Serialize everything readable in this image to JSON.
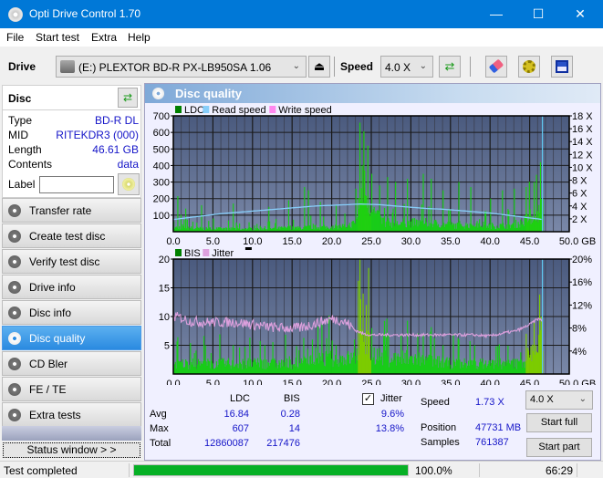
{
  "window": {
    "title": "Opti Drive Control 1.70",
    "minimize": "—",
    "maximize": "☐",
    "close": "✕"
  },
  "menu": [
    "File",
    "Start test",
    "Extra",
    "Help"
  ],
  "toolbar": {
    "drive_label": "Drive",
    "drive_value": "(E:)  PLEXTOR BD-R  PX-LB950SA 1.06",
    "speed_label": "Speed",
    "speed_value": "4.0 X",
    "eject_icon": "⏏",
    "refresh_icon": "⇄",
    "erase_icon": "eraser",
    "settings_icon": "gears",
    "save_icon": "floppy"
  },
  "disc": {
    "header": "Disc",
    "fields": [
      {
        "key": "Type",
        "value": "BD-R DL"
      },
      {
        "key": "MID",
        "value": "RITEKDR3 (000)"
      },
      {
        "key": "Length",
        "value": "46.61 GB"
      },
      {
        "key": "Contents",
        "value": "data"
      }
    ],
    "label_key": "Label",
    "label_value": ""
  },
  "nav": [
    {
      "label": "Transfer rate",
      "active": false
    },
    {
      "label": "Create test disc",
      "active": false
    },
    {
      "label": "Verify test disc",
      "active": false
    },
    {
      "label": "Drive info",
      "active": false
    },
    {
      "label": "Disc info",
      "active": false
    },
    {
      "label": "Disc quality",
      "active": true
    },
    {
      "label": "CD Bler",
      "active": false
    },
    {
      "label": "FE / TE",
      "active": false
    },
    {
      "label": "Extra tests",
      "active": false
    }
  ],
  "status_window_label": "Status window > >",
  "panel_title": "Disc quality",
  "chart_data": [
    {
      "type": "bar",
      "title": "LDC / Read speed",
      "legend": [
        {
          "name": "LDC",
          "color": "#008000"
        },
        {
          "name": "Read speed",
          "color": "#87cefa"
        },
        {
          "name": "Write speed",
          "color": "#ff88ee"
        }
      ],
      "legend_placement": "top-left",
      "xlabel": "GB",
      "xlim": [
        0,
        50
      ],
      "x_ticks": [
        "0.0",
        "5.0",
        "10.0",
        "15.0",
        "20.0",
        "25.0",
        "30.0",
        "35.0",
        "40.0",
        "45.0",
        "50.0 GB"
      ],
      "ylim_left": [
        0,
        700
      ],
      "y_ticks_left": [
        "700",
        "600",
        "500",
        "400",
        "300",
        "200",
        "100"
      ],
      "ylim_right": [
        0,
        18
      ],
      "y_ticks_right": [
        "18 X",
        "16 X",
        "14 X",
        "12 X",
        "10 X",
        "8 X",
        "6 X",
        "4 X",
        "2 X"
      ],
      "grid": true,
      "ldc_profile": {
        "x": [
          0,
          0.5,
          1.0,
          2.0,
          4.0,
          6.0,
          8.0,
          10.0,
          12.0,
          14.0,
          15.0,
          16.0,
          17.0,
          18.0,
          20.0,
          22.0,
          23.0,
          23.5,
          24.0,
          24.5,
          25.0,
          26.0,
          27.0,
          28.0,
          29.0,
          30.0,
          32.0,
          34.0,
          36.0,
          38.0,
          40.0,
          42.0,
          43.0,
          44.0,
          45.0,
          46.0,
          46.6
        ],
        "base": [
          30,
          25,
          35,
          25,
          20,
          20,
          20,
          20,
          20,
          25,
          25,
          25,
          30,
          30,
          30,
          40,
          60,
          250,
          300,
          250,
          150,
          80,
          60,
          50,
          60,
          60,
          60,
          50,
          40,
          50,
          40,
          40,
          50,
          60,
          100,
          120,
          160
        ],
        "peaks": [
          [
            0.5,
            215
          ],
          [
            1.5,
            140
          ],
          [
            3.5,
            160
          ],
          [
            5.0,
            80
          ],
          [
            7.5,
            170
          ],
          [
            12.0,
            150
          ],
          [
            14.5,
            190
          ],
          [
            16.5,
            270
          ],
          [
            17.0,
            250
          ],
          [
            18.5,
            180
          ],
          [
            20.5,
            160
          ],
          [
            23.0,
            260
          ],
          [
            23.8,
            400
          ],
          [
            24.0,
            607
          ],
          [
            24.5,
            520
          ],
          [
            25.0,
            350
          ],
          [
            26.0,
            280
          ],
          [
            27.0,
            330
          ],
          [
            28.0,
            300
          ],
          [
            29.5,
            320
          ],
          [
            31.5,
            350
          ],
          [
            32.5,
            320
          ],
          [
            34.0,
            250
          ],
          [
            36.0,
            300
          ],
          [
            37.5,
            270
          ],
          [
            40.0,
            200
          ],
          [
            41.5,
            250
          ],
          [
            43.0,
            260
          ],
          [
            44.5,
            270
          ],
          [
            45.5,
            300
          ],
          [
            46.3,
            420
          ]
        ]
      },
      "read_speed": {
        "x": [
          0,
          2,
          4,
          6,
          8,
          10,
          12,
          14,
          16,
          18,
          20,
          22,
          23.6,
          26,
          28,
          30,
          32,
          34,
          36,
          38,
          40,
          42,
          44,
          46.6
        ],
        "y": [
          1.9,
          2.2,
          2.5,
          2.8,
          3.0,
          3.2,
          3.4,
          3.6,
          3.8,
          4.0,
          4.1,
          4.2,
          4.3,
          4.2,
          4.0,
          3.8,
          3.6,
          3.5,
          3.3,
          3.1,
          2.9,
          2.6,
          2.3,
          1.9
        ]
      },
      "end_marker_gb": 46.61
    },
    {
      "type": "bar",
      "title": "BIS / Jitter",
      "legend": [
        {
          "name": "BIS",
          "color": "#008000"
        },
        {
          "name": "Jitter",
          "color": "#dda0dd"
        }
      ],
      "legend_placement": "top-left",
      "xlabel": "GB",
      "xlim": [
        0,
        50
      ],
      "x_ticks": [
        "0.0",
        "5.0",
        "10.0",
        "15.0",
        "20.0",
        "25.0",
        "30.0",
        "35.0",
        "40.0",
        "45.0",
        "50.0 GB"
      ],
      "ylim_left": [
        0,
        20
      ],
      "y_ticks_left": [
        "20",
        "15",
        "10",
        "5"
      ],
      "ylim_right": [
        0,
        20
      ],
      "y_ticks_right": [
        "20%",
        "16%",
        "12%",
        "8%",
        "4%"
      ],
      "grid": true,
      "bis_profile": {
        "x": [
          0,
          5,
          10,
          15,
          17,
          20,
          23,
          23.5,
          24,
          25,
          27,
          30,
          35,
          40,
          44,
          45,
          46.6
        ],
        "base": [
          2,
          2,
          2,
          2,
          2.5,
          3,
          3,
          7,
          8,
          4,
          3,
          3,
          2,
          2,
          2,
          4,
          6
        ],
        "peaks": [
          [
            4.0,
            5
          ],
          [
            7.5,
            5
          ],
          [
            11.5,
            5
          ],
          [
            17.5,
            6
          ],
          [
            20.5,
            5
          ],
          [
            22.8,
            6
          ],
          [
            23.6,
            13
          ],
          [
            23.9,
            14
          ],
          [
            24.3,
            12
          ],
          [
            25.0,
            8
          ],
          [
            26.5,
            7
          ],
          [
            29.5,
            7
          ],
          [
            31.5,
            7
          ],
          [
            34.0,
            5
          ],
          [
            36.0,
            6
          ],
          [
            38.0,
            5
          ],
          [
            44.5,
            7
          ],
          [
            45.5,
            9
          ],
          [
            46.4,
            10
          ]
        ]
      },
      "jitter_pct": {
        "x": [
          0,
          1,
          2,
          4,
          6,
          8,
          10,
          12,
          14,
          15,
          16,
          17,
          18,
          19,
          20,
          21,
          22,
          23,
          24,
          25,
          28,
          30,
          35,
          38,
          40,
          41,
          42,
          43,
          44,
          45,
          46,
          46.6
        ],
        "y": [
          10.0,
          9.8,
          9.2,
          9.0,
          9.0,
          9.0,
          8.6,
          8.2,
          8.0,
          8.0,
          8.0,
          8.4,
          8.8,
          9.2,
          9.6,
          9.4,
          8.8,
          7.6,
          7.0,
          6.8,
          6.8,
          6.8,
          6.8,
          6.8,
          6.6,
          6.9,
          7.2,
          7.4,
          7.9,
          8.6,
          9.6,
          9.4
        ]
      },
      "end_marker_gb": 46.61
    }
  ],
  "stats": {
    "col_ldc": "LDC",
    "col_bis": "BIS",
    "rows": [
      {
        "label": "Avg",
        "ldc": "16.84",
        "bis": "0.28",
        "jitter": "9.6%"
      },
      {
        "label": "Max",
        "ldc": "607",
        "bis": "14",
        "jitter": "13.8%"
      },
      {
        "label": "Total",
        "ldc": "12860087",
        "bis": "217476"
      }
    ],
    "jitter_label": "Jitter",
    "jitter_checked": true,
    "speed_label": "Speed",
    "speed_value": "1.73 X",
    "position_label": "Position",
    "position_value": "47731 MB",
    "samples_label": "Samples",
    "samples_value": "761387",
    "speed_select": "4.0 X",
    "start_full": "Start full",
    "start_part": "Start part"
  },
  "statusbar": {
    "text": "Test completed",
    "progress_pct": 100.0,
    "progress_text": "100.0%",
    "time": "66:29"
  }
}
